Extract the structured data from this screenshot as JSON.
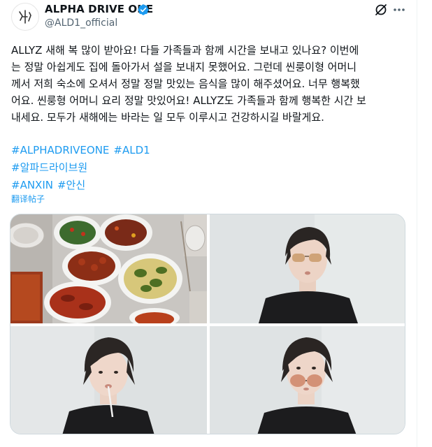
{
  "tweet": {
    "display_name": "ALPHA DRIVE ONE",
    "handle": "@ALD1_official",
    "body": "ALLYZ 새해 복 많이 받아요! 다들 가족들과 함께 시간을 보내고 있나요? 이번에\n는 정말 아쉽게도 집에 돌아가서 설을 보내지 못했어요. 그런데 씬룽이형 어머니\n께서 저희 숙소에 오셔서 정말 정말 맛있는 음식을 많이 해주셨어요. 너무 행복했\n어요. 씬룽형 어머니 요리 정말 맛있어요! ALLYZ도 가족들과 함께 행복한 시간 보\n내세요. 모두가 새해에는 바라는 일 모두 이루시고 건강하시길 바랄게요.",
    "hashtags": [
      [
        "#ALPHADRIVEONE",
        "#ALD1"
      ],
      [
        "#알파드라이브원"
      ],
      [
        "#ANXIN",
        "#안신"
      ]
    ],
    "translate_label": "翻译帖子"
  },
  "icons": {
    "avatar": "ald1-logo",
    "verified": "verified-badge-icon",
    "grok": "grok-icon",
    "more": "more-icon"
  },
  "colors": {
    "link": "#1d9bf0",
    "text": "#0f1419",
    "secondary": "#536471"
  }
}
